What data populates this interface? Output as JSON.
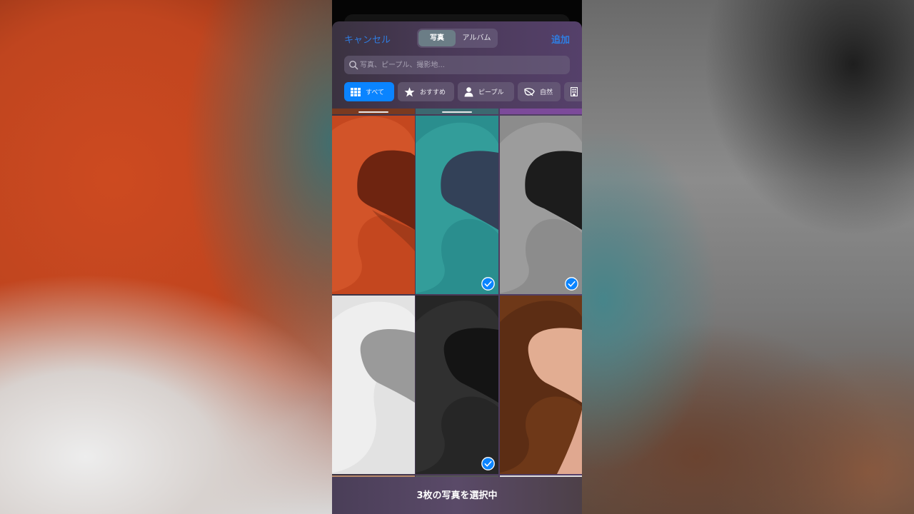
{
  "nav": {
    "cancel_label": "キャンセル",
    "add_label": "追加",
    "segments": [
      "写真",
      "アルバム"
    ],
    "selected_segment": "写真"
  },
  "search": {
    "placeholder": "写真、ピープル、撮影地...",
    "icon": "search-icon"
  },
  "filter_chips": [
    {
      "label": "すべて",
      "icon": "grid-icon",
      "selected": true
    },
    {
      "label": "おすすめ",
      "icon": "star-icon",
      "selected": false
    },
    {
      "label": "ピープル",
      "icon": "person-icon",
      "selected": false
    },
    {
      "label": "自然",
      "icon": "leaf-icon",
      "selected": false
    },
    {
      "label": "",
      "icon": "building-icon",
      "selected": false
    }
  ],
  "photos": [
    {
      "name": "orange",
      "selected": false
    },
    {
      "name": "teal",
      "selected": true
    },
    {
      "name": "gray",
      "selected": true
    },
    {
      "name": "white",
      "selected": false
    },
    {
      "name": "black",
      "selected": true
    },
    {
      "name": "brown",
      "selected": false
    }
  ],
  "footer": {
    "selection_text": "3枚の写真を選択中"
  },
  "colors": {
    "accent": "#0a84ff",
    "link": "#2f7de1"
  }
}
